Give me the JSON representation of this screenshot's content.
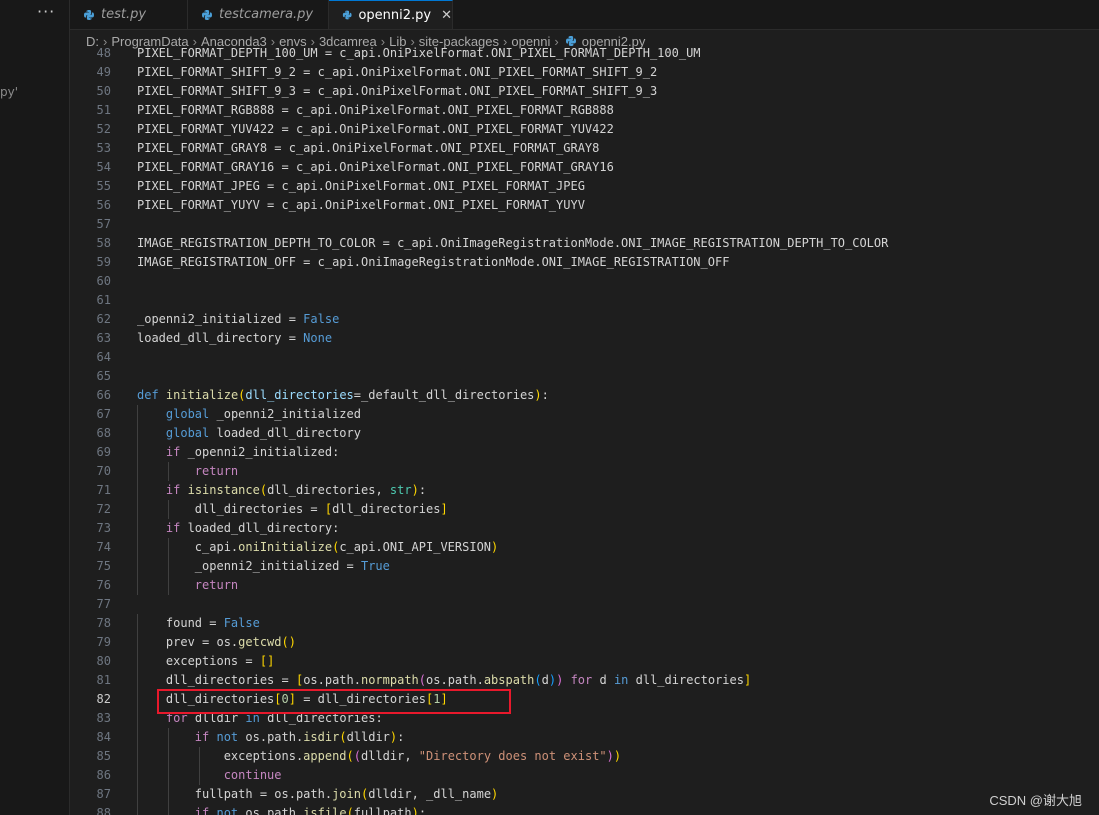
{
  "sidebar": {
    "overflow_label": "···",
    "partial_text": "py'"
  },
  "tabs": [
    {
      "label": "test.py",
      "active": false
    },
    {
      "label": "testcamera.py",
      "active": false
    },
    {
      "label": "openni2.py",
      "active": true,
      "close": "✕"
    }
  ],
  "breadcrumb": [
    "D:",
    "ProgramData",
    "Anaconda3",
    "envs",
    "3dcamrea",
    "Lib",
    "site-packages",
    "openni",
    "openni2.py"
  ],
  "editor": {
    "current_line": 82,
    "lines": [
      {
        "n": 48,
        "text": "PIXEL_FORMAT_DEPTH_100_UM = c_api.OniPixelFormat.ONI_PIXEL_FORMAT_DEPTH_100_UM"
      },
      {
        "n": 49,
        "text": "PIXEL_FORMAT_SHIFT_9_2 = c_api.OniPixelFormat.ONI_PIXEL_FORMAT_SHIFT_9_2"
      },
      {
        "n": 50,
        "text": "PIXEL_FORMAT_SHIFT_9_3 = c_api.OniPixelFormat.ONI_PIXEL_FORMAT_SHIFT_9_3"
      },
      {
        "n": 51,
        "text": "PIXEL_FORMAT_RGB888 = c_api.OniPixelFormat.ONI_PIXEL_FORMAT_RGB888"
      },
      {
        "n": 52,
        "text": "PIXEL_FORMAT_YUV422 = c_api.OniPixelFormat.ONI_PIXEL_FORMAT_YUV422"
      },
      {
        "n": 53,
        "text": "PIXEL_FORMAT_GRAY8 = c_api.OniPixelFormat.ONI_PIXEL_FORMAT_GRAY8"
      },
      {
        "n": 54,
        "text": "PIXEL_FORMAT_GRAY16 = c_api.OniPixelFormat.ONI_PIXEL_FORMAT_GRAY16"
      },
      {
        "n": 55,
        "text": "PIXEL_FORMAT_JPEG = c_api.OniPixelFormat.ONI_PIXEL_FORMAT_JPEG"
      },
      {
        "n": 56,
        "text": "PIXEL_FORMAT_YUYV = c_api.OniPixelFormat.ONI_PIXEL_FORMAT_YUYV"
      },
      {
        "n": 57,
        "text": ""
      },
      {
        "n": 58,
        "text": "IMAGE_REGISTRATION_DEPTH_TO_COLOR = c_api.OniImageRegistrationMode.ONI_IMAGE_REGISTRATION_DEPTH_TO_COLOR"
      },
      {
        "n": 59,
        "text": "IMAGE_REGISTRATION_OFF = c_api.OniImageRegistrationMode.ONI_IMAGE_REGISTRATION_OFF"
      },
      {
        "n": 60,
        "text": ""
      },
      {
        "n": 61,
        "text": ""
      },
      {
        "n": 62,
        "text": "_openni2_initialized = False"
      },
      {
        "n": 63,
        "text": "loaded_dll_directory = None"
      },
      {
        "n": 64,
        "text": ""
      },
      {
        "n": 65,
        "text": ""
      },
      {
        "n": 66,
        "text": "def initialize(dll_directories=_default_dll_directories):"
      },
      {
        "n": 67,
        "text": "    global _openni2_initialized"
      },
      {
        "n": 68,
        "text": "    global loaded_dll_directory"
      },
      {
        "n": 69,
        "text": "    if _openni2_initialized:"
      },
      {
        "n": 70,
        "text": "        return"
      },
      {
        "n": 71,
        "text": "    if isinstance(dll_directories, str):"
      },
      {
        "n": 72,
        "text": "        dll_directories = [dll_directories]"
      },
      {
        "n": 73,
        "text": "    if loaded_dll_directory:"
      },
      {
        "n": 74,
        "text": "        c_api.oniInitialize(c_api.ONI_API_VERSION)"
      },
      {
        "n": 75,
        "text": "        _openni2_initialized = True"
      },
      {
        "n": 76,
        "text": "        return"
      },
      {
        "n": 77,
        "text": ""
      },
      {
        "n": 78,
        "text": "    found = False"
      },
      {
        "n": 79,
        "text": "    prev = os.getcwd()"
      },
      {
        "n": 80,
        "text": "    exceptions = []"
      },
      {
        "n": 81,
        "text": "    dll_directories = [os.path.normpath(os.path.abspath(d)) for d in dll_directories]"
      },
      {
        "n": 82,
        "text": "    dll_directories[0] = dll_directories[1]"
      },
      {
        "n": 83,
        "text": "    for dlldir in dll_directories:"
      },
      {
        "n": 84,
        "text": "        if not os.path.isdir(dlldir):"
      },
      {
        "n": 85,
        "text": "            exceptions.append((dlldir, \"Directory does not exist\"))"
      },
      {
        "n": 86,
        "text": "            continue"
      },
      {
        "n": 87,
        "text": "        fullpath = os.path.join(dlldir, _dll_name)"
      },
      {
        "n": 88,
        "text": "        if not os.path.isfile(fullpath):"
      }
    ]
  },
  "watermark": "CSDN @谢大旭"
}
